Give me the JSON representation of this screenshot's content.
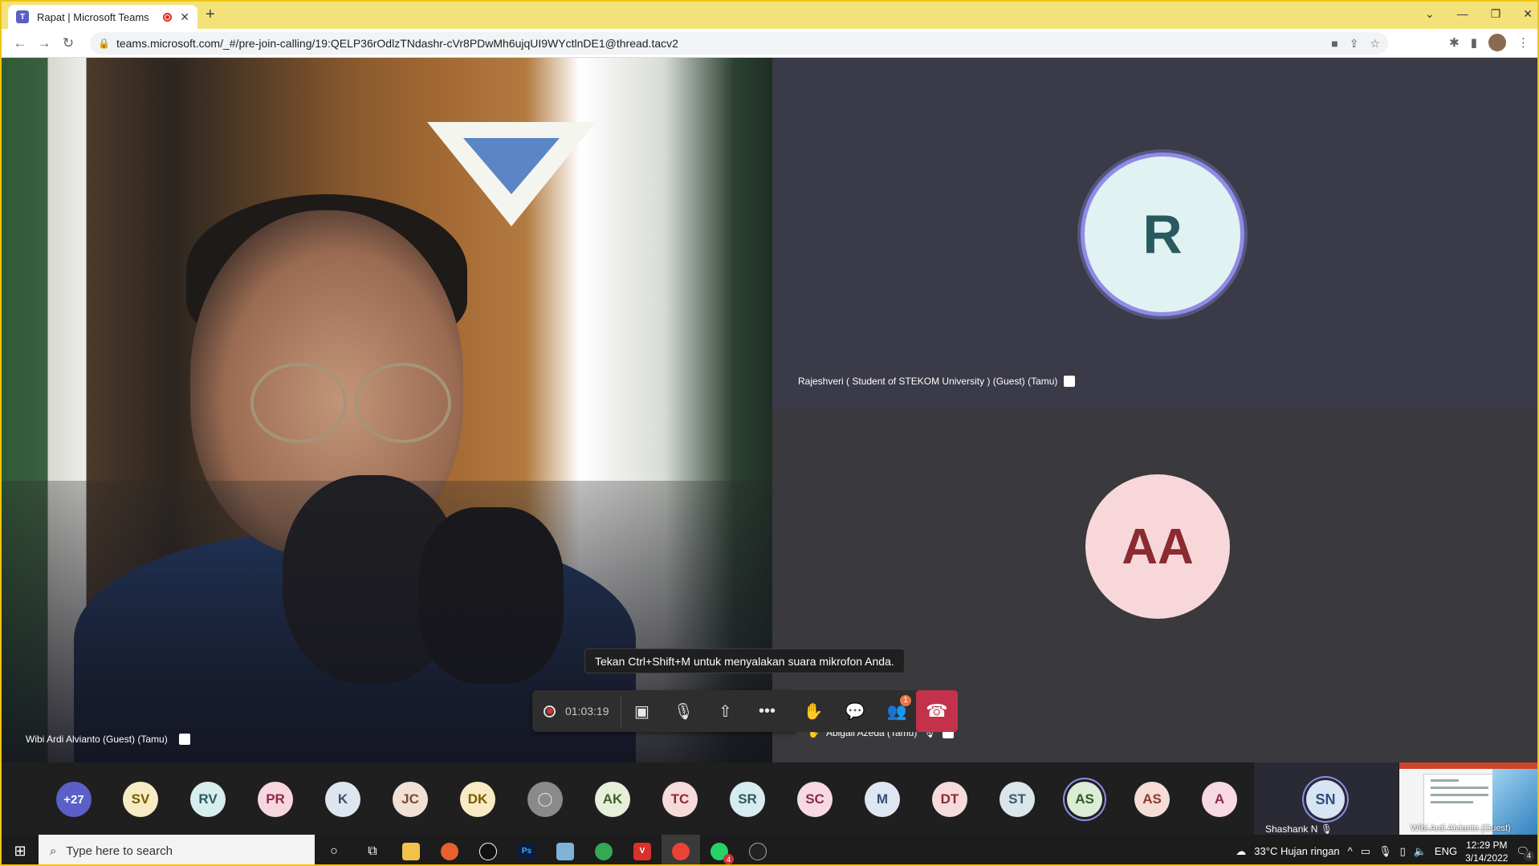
{
  "browser": {
    "tab_title": "Rapat | Microsoft Teams",
    "tab_icon": "T",
    "url": "teams.microsoft.com/_#/pre-join-calling/19:QELP36rOdlzTNdashr-cVr8PDwMh6ujqUI9WYctlnDE1@thread.tacv2"
  },
  "meeting": {
    "main_participant": "Wibi Ardi Alvianto (Guest) (Tamu)",
    "tile_r": {
      "initial": "R",
      "name": "Rajeshveri ( Student of STEKOM University ) (Guest) (Tamu)"
    },
    "tile_aa": {
      "initial": "AA",
      "name": "Abigail Azeda (Tamu)"
    },
    "tooltip": "Tekan Ctrl+Shift+M untuk menyalakan suara mikrofon Anda.",
    "timer": "01:03:19",
    "participants_badge": "1",
    "overflow_count": "+27",
    "attendees": [
      {
        "initials": "SV",
        "bg": "#f6ecc3",
        "fg": "#7a5a00"
      },
      {
        "initials": "RV",
        "bg": "#d6eeee",
        "fg": "#2b5b5e"
      },
      {
        "initials": "PR",
        "bg": "#f6d7df",
        "fg": "#8b2a47"
      },
      {
        "initials": "K",
        "bg": "#dde6ef",
        "fg": "#3a5068"
      },
      {
        "initials": "JC",
        "bg": "#f1e0d6",
        "fg": "#7a4a2a"
      },
      {
        "initials": "DK",
        "bg": "#f8eac2",
        "fg": "#7a5a00"
      },
      {
        "initials": "",
        "bg": "#8a8a8a",
        "fg": "#e0e0e0"
      },
      {
        "initials": "AK",
        "bg": "#e7efdb",
        "fg": "#3e5e22"
      },
      {
        "initials": "TC",
        "bg": "#f6dbdd",
        "fg": "#8b2a31"
      },
      {
        "initials": "SR",
        "bg": "#d7ecee",
        "fg": "#2b5b5e"
      },
      {
        "initials": "SC",
        "bg": "#f6d9e2",
        "fg": "#8b2a47"
      },
      {
        "initials": "M",
        "bg": "#dde6f1",
        "fg": "#2f4e7a"
      },
      {
        "initials": "DT",
        "bg": "#f6dbdd",
        "fg": "#8b2a31"
      },
      {
        "initials": "ST",
        "bg": "#dbe6ea",
        "fg": "#3a5a68"
      },
      {
        "initials": "AS",
        "bg": "#dcecd6",
        "fg": "#2e5a22"
      },
      {
        "initials": "AS",
        "bg": "#f6dcd6",
        "fg": "#8b3a2a"
      },
      {
        "initials": "A",
        "bg": "#f6d9e2",
        "fg": "#8b2a47"
      }
    ],
    "spotlight": {
      "initials": "SN",
      "name": "Shashank N"
    },
    "screenshare_label": "Wibi Ardi Alvianto (Guest)"
  },
  "taskbar": {
    "search_placeholder": "Type here to search",
    "weather": "33°C  Hujan ringan",
    "lang": "ENG",
    "time": "12:29 PM",
    "date": "3/14/2022",
    "notif": "4",
    "chat_notif": "4"
  },
  "colors": {
    "accent": "#8e8ce8",
    "hangup": "#c4314b",
    "tab_bar": "#f3e27a"
  }
}
